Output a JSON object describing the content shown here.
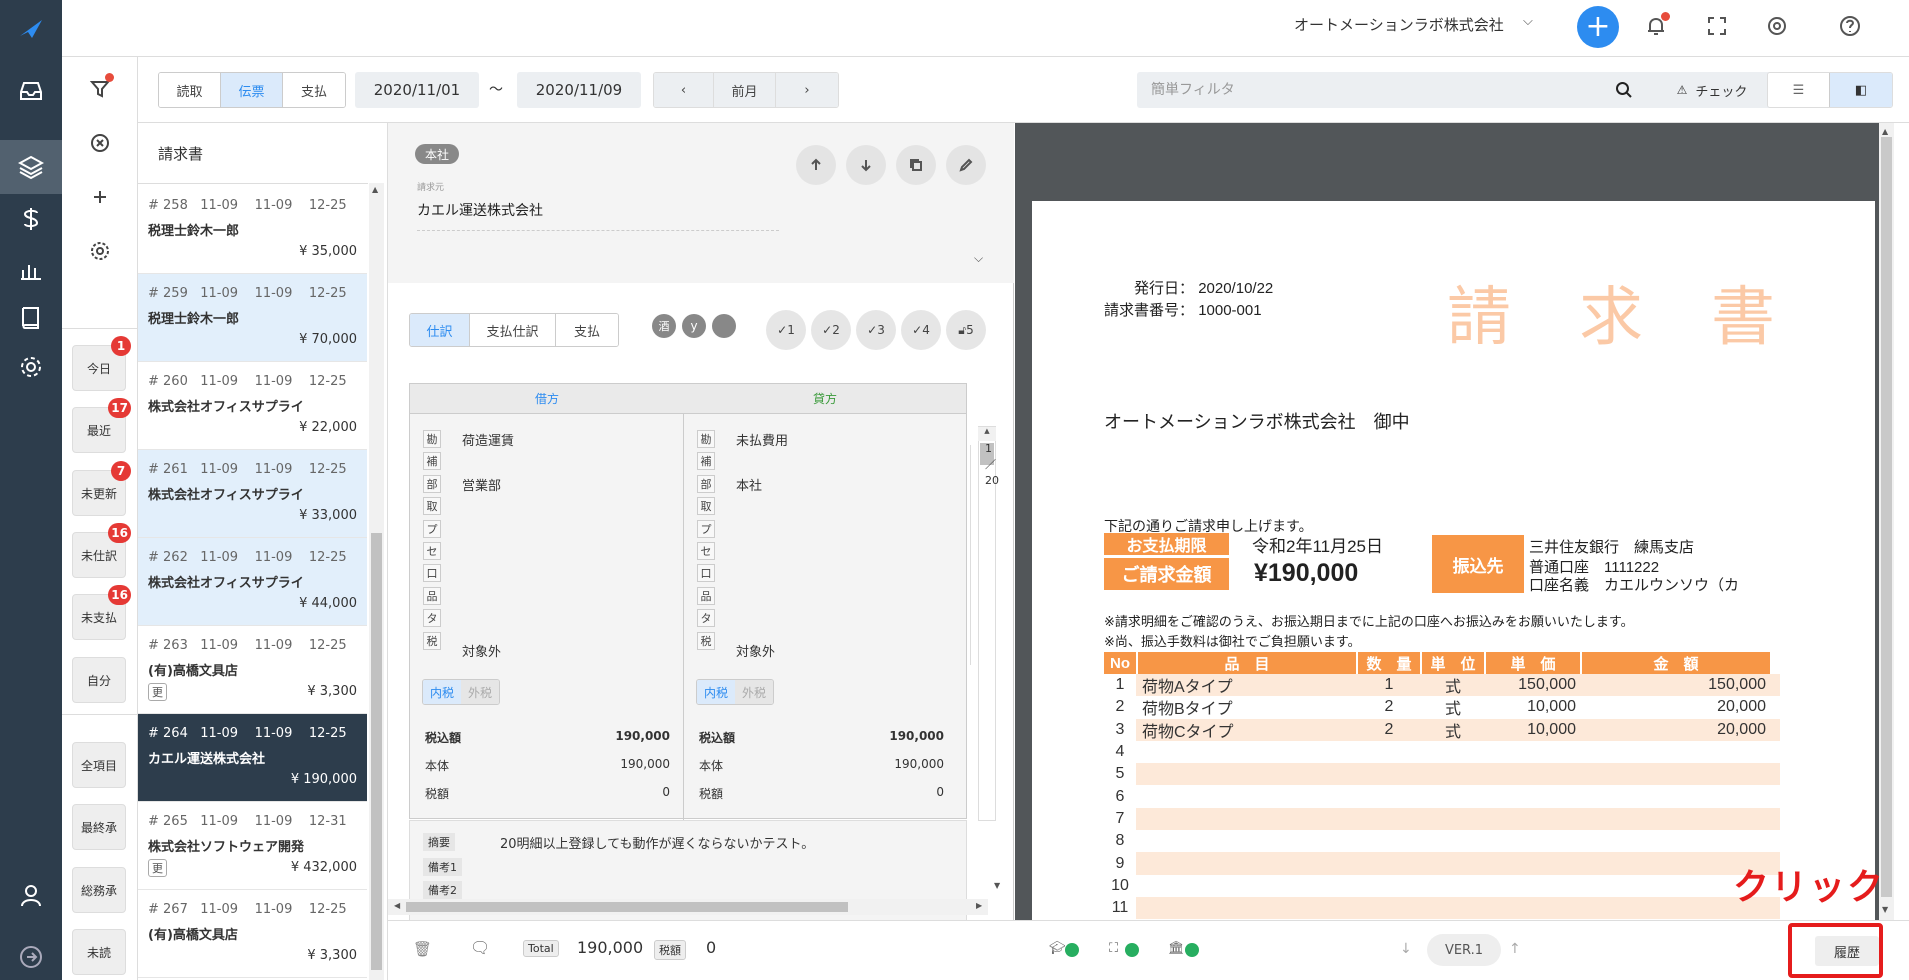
{
  "header": {
    "company": "オートメーションラボ株式会社"
  },
  "filters": {
    "today": "今日",
    "today_count": "1",
    "recent": "最近",
    "recent_count": "17",
    "unupdated": "未更新",
    "unupdated_count": "7",
    "unjournal": "未仕訳",
    "unjournal_count": "16",
    "unpaid": "未支払",
    "unpaid_count": "16",
    "mine": "自分",
    "all_items": "全項目",
    "final_approval": "最終承",
    "general_approval": "総務承",
    "unread": "未読"
  },
  "toolbar": {
    "tabs": [
      "読取",
      "伝票",
      "支払"
    ],
    "date_from": "2020/11/01",
    "tilde": "〜",
    "date_to": "2020/11/09",
    "prev_month": "前月",
    "search_placeholder": "簡単フィルタ",
    "check": "チェック"
  },
  "list": {
    "title": "請求書",
    "items": [
      {
        "no": "# 258",
        "d1": "11-09",
        "d2": "11-09",
        "d3": "12-25",
        "name": "税理士鈴木一郎",
        "amount": "¥ 35,000",
        "tag": ""
      },
      {
        "no": "# 259",
        "d1": "11-09",
        "d2": "11-09",
        "d3": "12-25",
        "name": "税理士鈴木一郎",
        "amount": "¥ 70,000",
        "tag": ""
      },
      {
        "no": "# 260",
        "d1": "11-09",
        "d2": "11-09",
        "d3": "12-25",
        "name": "株式会社オフィスサプライ",
        "amount": "¥ 22,000",
        "tag": ""
      },
      {
        "no": "# 261",
        "d1": "11-09",
        "d2": "11-09",
        "d3": "12-25",
        "name": "株式会社オフィスサプライ",
        "amount": "¥ 33,000",
        "tag": ""
      },
      {
        "no": "# 262",
        "d1": "11-09",
        "d2": "11-09",
        "d3": "12-25",
        "name": "株式会社オフィスサプライ",
        "amount": "¥ 44,000",
        "tag": ""
      },
      {
        "no": "# 263",
        "d1": "11-09",
        "d2": "11-09",
        "d3": "12-25",
        "name": "(有)高橋文具店",
        "amount": "¥ 3,300",
        "tag": "更"
      },
      {
        "no": "# 264",
        "d1": "11-09",
        "d2": "11-09",
        "d3": "12-25",
        "name": "カエル運送株式会社",
        "amount": "¥ 190,000",
        "tag": ""
      },
      {
        "no": "# 265",
        "d1": "11-09",
        "d2": "11-09",
        "d3": "12-31",
        "name": "株式会社ソフトウェア開発",
        "amount": "¥ 432,000",
        "tag": "更"
      },
      {
        "no": "# 267",
        "d1": "11-09",
        "d2": "11-09",
        "d3": "12-25",
        "name": "(有)高橋文具店",
        "amount": "¥ 3,300",
        "tag": ""
      }
    ]
  },
  "detail": {
    "branch": "本社",
    "billing_label": "請求元",
    "vendor": "カエル運送株式会社",
    "tabs": [
      "仕訳",
      "支払仕訳",
      "支払"
    ],
    "chips": [
      "酒",
      "y"
    ],
    "checks": [
      "1",
      "2",
      "3",
      "4",
      "5"
    ],
    "debit": {
      "head": "借方",
      "labels": [
        "勘",
        "補",
        "部",
        "取",
        "プ",
        "セ",
        "口",
        "品",
        "タ",
        "税"
      ],
      "account": "荷造運賃",
      "dept": "営業部",
      "tax": "対象外",
      "tax_in": "内税",
      "tax_out": "外税",
      "incl_label": "税込額",
      "incl": "190,000",
      "body_label": "本体",
      "body": "190,000",
      "taxamt_label": "税額",
      "taxamt": "0"
    },
    "credit": {
      "head": "貸方",
      "labels": [
        "勘",
        "補",
        "部",
        "取",
        "プ",
        "セ",
        "口",
        "品",
        "タ",
        "税"
      ],
      "account": "未払費用",
      "dept": "本社",
      "tax": "対象外",
      "tax_in": "内税",
      "tax_out": "外税",
      "incl_label": "税込額",
      "incl": "190,000",
      "body_label": "本体",
      "body": "190,000",
      "taxamt_label": "税額",
      "taxamt": "0"
    },
    "side": [
      "1",
      "／",
      "20"
    ],
    "memo_label": "摘要",
    "memo": "20明細以上登録しても動作が遅くならないかテスト。",
    "note1": "備考1",
    "note2": "備考2",
    "total_label": "Total",
    "total": "190,000",
    "tax_label": "税額",
    "tax": "0"
  },
  "invoice": {
    "issue_label": "発行日：",
    "issue_date": "2020/10/22",
    "number_label": "請求書番号：",
    "number": "1000-001",
    "title": "請　求　書",
    "recipient": "オートメーションラボ株式会社　御中",
    "intro": "下記の通りご請求申し上げます。",
    "due_label": "お支払期限",
    "due": "令和2年11月25日",
    "amount_label": "ご請求金額",
    "amount": "¥190,000",
    "bank_label": "振込先",
    "bank1": "三井住友銀行　練馬支店",
    "bank2": "普通口座　1111222",
    "bank3": "口座名義　カエルウンソウ（カ",
    "note1": "※請求明細をご確認のうえ、お振込期日までに上記の口座へお振込みをお願いいたします。",
    "note2": "※尚、振込手数料は御社でご負担願います。",
    "cols": [
      "No",
      "品　目",
      "数　量",
      "単　位",
      "単　価",
      "金　額"
    ],
    "rows": [
      [
        "1",
        "荷物Aタイプ",
        "1",
        "式",
        "150,000",
        "150,000"
      ],
      [
        "2",
        "荷物Bタイプ",
        "2",
        "式",
        "10,000",
        "20,000"
      ],
      [
        "3",
        "荷物Cタイプ",
        "2",
        "式",
        "10,000",
        "20,000"
      ],
      [
        "4",
        "",
        "",
        "",
        "",
        ""
      ],
      [
        "5",
        "",
        "",
        "",
        "",
        ""
      ],
      [
        "6",
        "",
        "",
        "",
        "",
        ""
      ],
      [
        "7",
        "",
        "",
        "",
        "",
        ""
      ],
      [
        "8",
        "",
        "",
        "",
        "",
        ""
      ],
      [
        "9",
        "",
        "",
        "",
        "",
        ""
      ],
      [
        "10",
        "",
        "",
        "",
        "",
        ""
      ],
      [
        "11",
        "",
        "",
        "",
        "",
        ""
      ]
    ]
  },
  "footer": {
    "version": "VER.1",
    "history": "履歴",
    "click_label": "クリック"
  },
  "colors": {
    "accent": "#2d8cf0",
    "sidebar": "#2d3d4c",
    "invoice_orange": "#f79646",
    "highlight": "#e51c1c"
  }
}
